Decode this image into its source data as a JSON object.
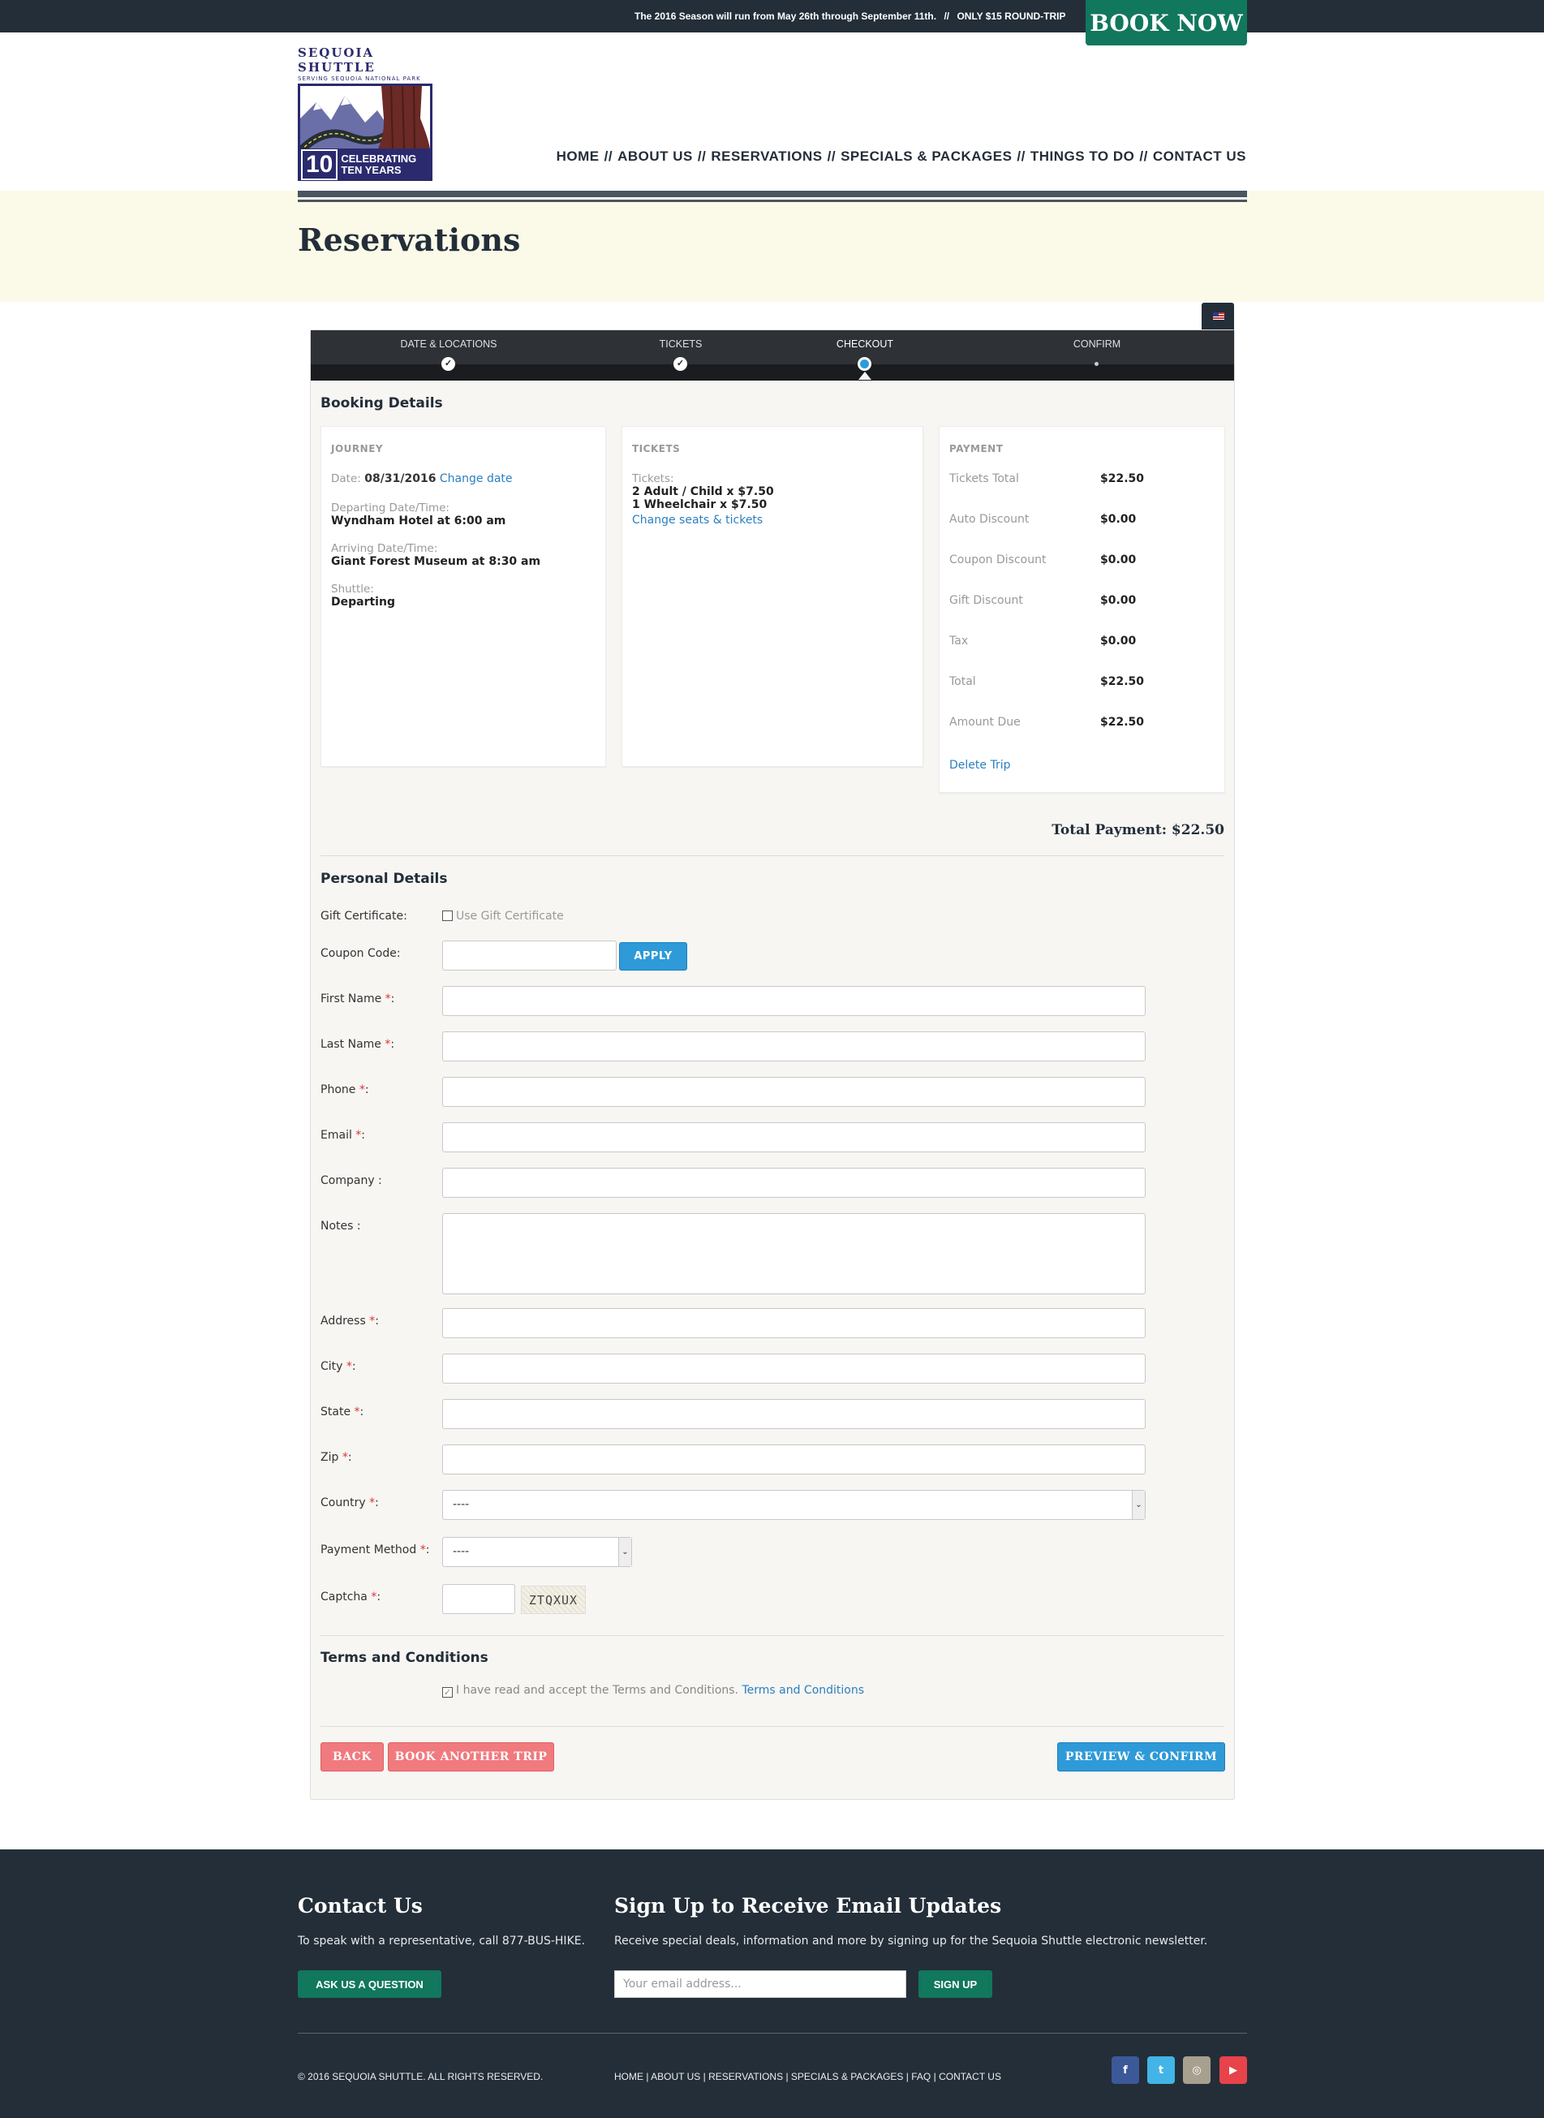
{
  "topbar": {
    "promo": "The 2016 Season will run from May 26th through September 11th.",
    "promo_sep": "//",
    "promo_price": "ONLY $15 ROUND-TRIP",
    "book_now": "BOOK NOW"
  },
  "logo": {
    "title": "SEQUOIA SHUTTLE",
    "subtitle": "SERVING SEQUOIA NATIONAL PARK",
    "badge_number": "10",
    "badge_line1": "CELEBRATING",
    "badge_line2": "TEN YEARS"
  },
  "nav": {
    "items": [
      "HOME",
      "ABOUT US",
      "RESERVATIONS",
      "SPECIALS & PACKAGES",
      "THINGS TO DO",
      "CONTACT US"
    ],
    "separator": "//"
  },
  "page_title": "Reservations",
  "steps": [
    {
      "label": "DATE & LOCATIONS",
      "state": "done",
      "mark": "✓"
    },
    {
      "label": "TICKETS",
      "state": "done",
      "mark": "✓"
    },
    {
      "label": "CHECKOUT",
      "state": "active",
      "mark": ""
    },
    {
      "label": "CONFIRM",
      "state": "pending",
      "mark": ""
    }
  ],
  "booking": {
    "heading": "Booking Details",
    "journey": {
      "heading": "JOURNEY",
      "date_label": "Date:",
      "date_value": "08/31/2016",
      "change_date": "Change date",
      "departing_label": "Departing Date/Time:",
      "departing_value": "Wyndham Hotel at 6:00 am",
      "arriving_label": "Arriving Date/Time:",
      "arriving_value": "Giant Forest Museum at 8:30 am",
      "shuttle_label": "Shuttle:",
      "shuttle_value": "Departing"
    },
    "tickets": {
      "heading": "TICKETS",
      "label": "Tickets:",
      "line1": "2 Adult / Child x $7.50",
      "line2": "1 Wheelchair x $7.50",
      "change_link": "Change seats & tickets"
    },
    "payment": {
      "heading": "PAYMENT",
      "rows": [
        {
          "label": "Tickets Total",
          "value": "$22.50"
        },
        {
          "label": "Auto Discount",
          "value": "$0.00"
        },
        {
          "label": "Coupon Discount",
          "value": "$0.00"
        },
        {
          "label": "Gift Discount",
          "value": "$0.00"
        },
        {
          "label": "Tax",
          "value": "$0.00"
        },
        {
          "label": "Total",
          "value": "$22.50"
        },
        {
          "label": "Amount Due",
          "value": "$22.50"
        }
      ],
      "delete_trip": "Delete Trip"
    },
    "total_payment": "Total Payment: $22.50"
  },
  "personal": {
    "heading": "Personal Details",
    "gift_label": "Gift Certificate:",
    "gift_checkbox": "Use Gift Certificate",
    "coupon_label": "Coupon Code:",
    "apply": "APPLY",
    "first_name": "First Name",
    "last_name": "Last Name",
    "phone": "Phone",
    "email": "Email",
    "company": "Company :",
    "notes": "Notes :",
    "address": "Address",
    "city": "City",
    "state": "State",
    "zip": "Zip",
    "country": "Country",
    "country_value": "----",
    "payment_method": "Payment Method",
    "payment_value": "----",
    "captcha": "Captcha",
    "captcha_text": "ZTQXUX",
    "req": "*",
    "colon": ":"
  },
  "terms": {
    "heading": "Terms and Conditions",
    "text": "I have read and accept the Terms and Conditions.",
    "link": "Terms and Conditions",
    "checked": "✓"
  },
  "actions": {
    "back": "BACK",
    "another": "BOOK ANOTHER TRIP",
    "preview": "PREVIEW & CONFIRM"
  },
  "footer": {
    "contact_title": "Contact Us",
    "contact_text": "To speak with a representative, call 877-BUS-HIKE.",
    "ask": "ASK US A QUESTION",
    "signup_title": "Sign Up to Receive Email Updates",
    "signup_text": "Receive special deals, information and more by signing up for the Sequoia Shuttle electronic newsletter.",
    "email_placeholder": "Your email address...",
    "signup_btn": "SIGN UP",
    "copyright": "© 2016 SEQUOIA SHUTTLE. ALL RIGHTS RESERVED.",
    "links": [
      "HOME",
      "ABOUT US",
      "RESERVATIONS",
      "SPECIALS & PACKAGES",
      "FAQ",
      "CONTACT US"
    ],
    "link_sep": "|",
    "social": [
      "f",
      "t",
      "◎",
      "▶"
    ]
  },
  "colors": {
    "dark": "#232e39",
    "green": "#11775d",
    "blue": "#2e9ad8",
    "pink": "#f07a7e",
    "facebook": "#3b5998",
    "twitter": "#42b4e6",
    "instagram": "#a8a08e",
    "youtube": "#e8424a"
  }
}
